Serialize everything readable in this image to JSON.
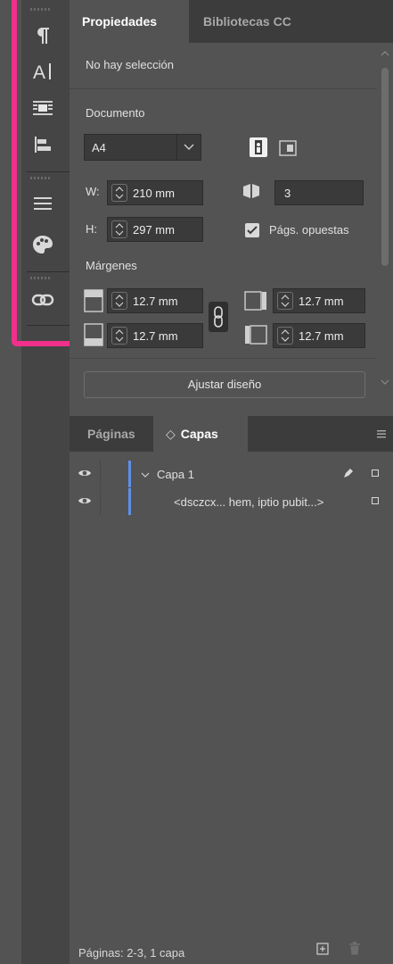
{
  "properties_tab": "Propiedades",
  "libraries_tab": "Bibliotecas CC",
  "no_selection": "No hay selección",
  "document_heading": "Documento",
  "page_size": "A4",
  "width_label": "W:",
  "width_value": "210 mm",
  "height_label": "H:",
  "height_value": "297 mm",
  "pages_count": "3",
  "facing_pages_label": "Págs. opuestas",
  "facing_pages_checked": true,
  "margins_heading": "Márgenes",
  "margin_top": "12.7 mm",
  "margin_bottom": "12.7 mm",
  "margin_inside": "12.7 mm",
  "margin_outside": "12.7 mm",
  "adjust_layout_button": "Ajustar diseño",
  "pages_tab": "Páginas",
  "layers_tab": "Capas",
  "layers_tab_prefix": "◇",
  "layers": [
    {
      "name": "Capa 1"
    },
    {
      "name": "<dsczcx... hem, iptio pubit...>"
    }
  ],
  "footer_status": "Páginas: 2-3, 1 capa",
  "colors": {
    "accent_highlight": "#f0308a",
    "layer_color": "#5f8fe8"
  },
  "toolbar_icons": [
    "paragraph-icon",
    "character-icon",
    "text-wrap-icon",
    "align-icon",
    "stroke-icon",
    "swatches-icon",
    "links-icon"
  ]
}
